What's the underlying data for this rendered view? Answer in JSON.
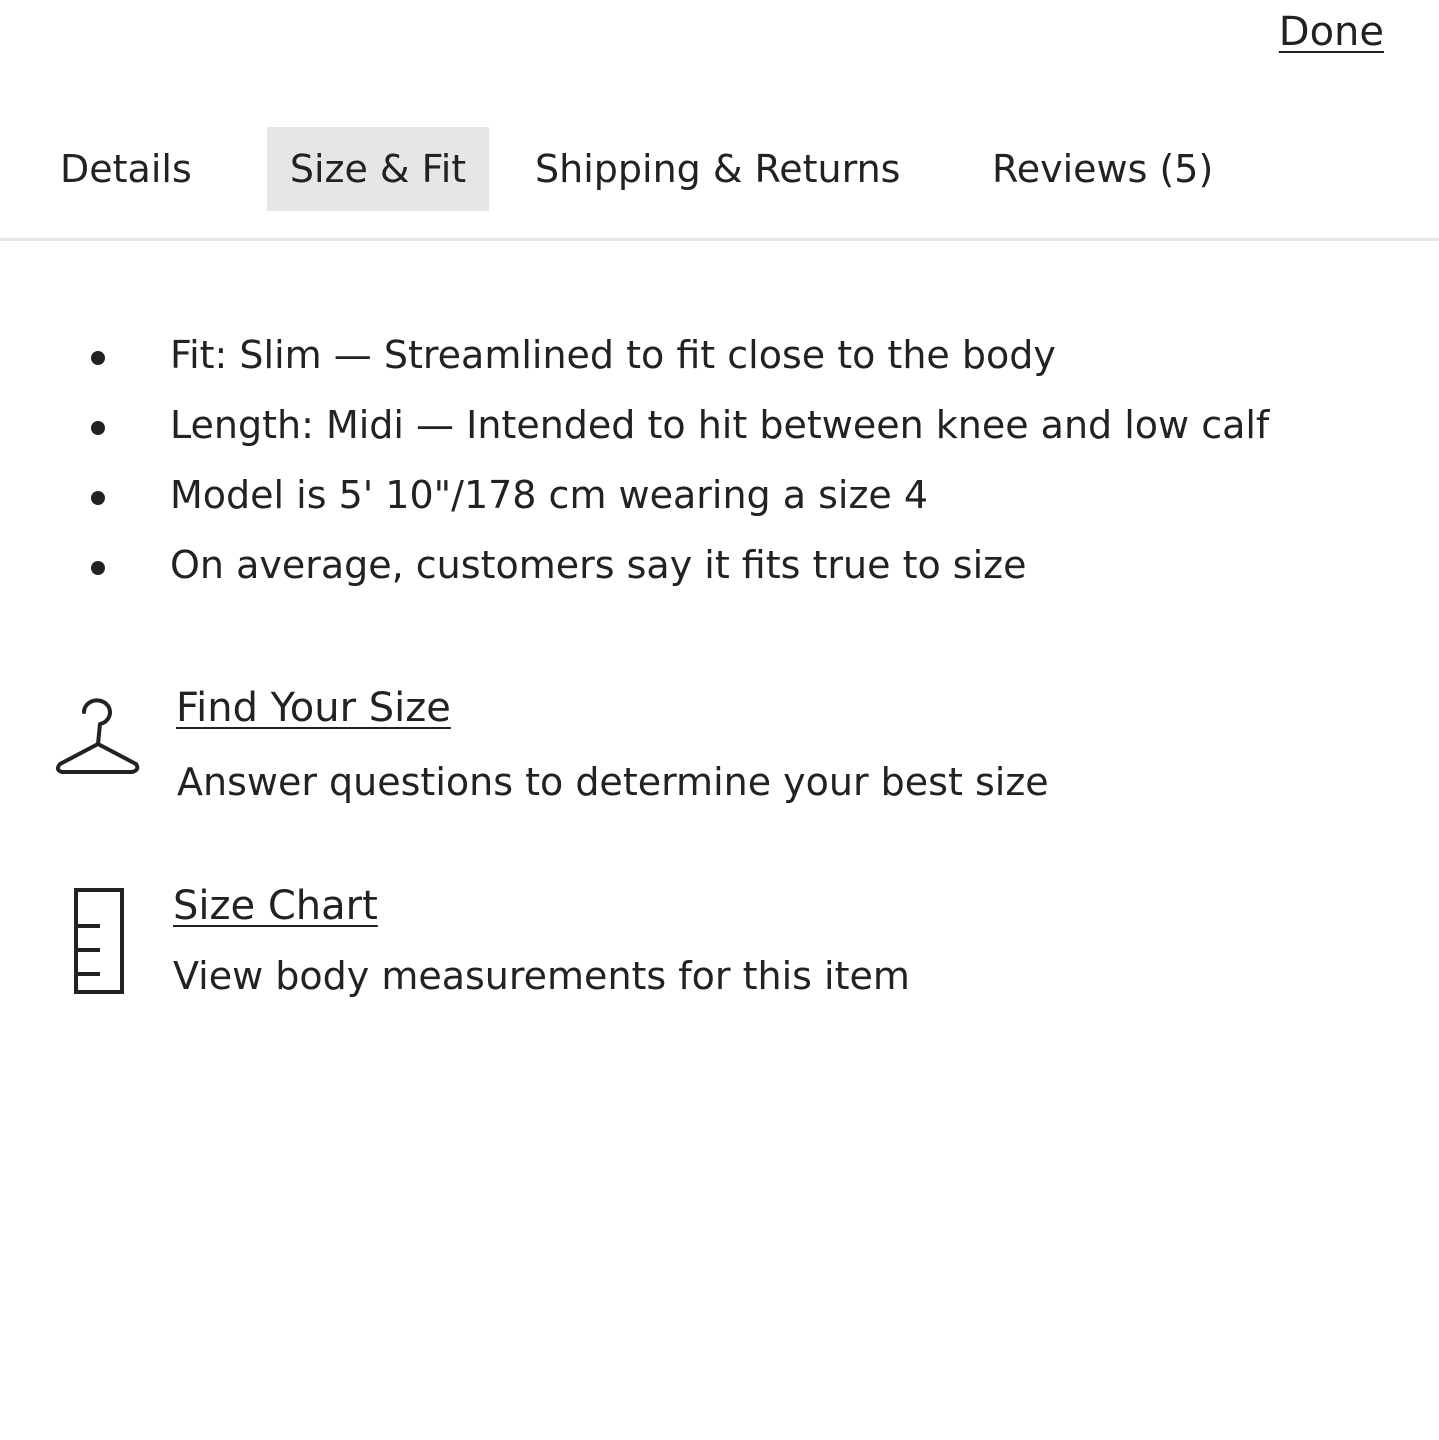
{
  "header": {
    "done_label": "Done"
  },
  "tabs": [
    {
      "label": "Details",
      "active": false
    },
    {
      "label": "Size & Fit",
      "active": true
    },
    {
      "label": "Shipping & Returns",
      "active": false
    },
    {
      "label": "Reviews (5)",
      "active": false
    }
  ],
  "fit_details": [
    "Fit: Slim — Streamlined to fit close to the body",
    "Length: Midi — Intended to hit between knee and low calf",
    "Model is 5' 10\"/178 cm wearing a size 4",
    "On average, customers say it fits true to size"
  ],
  "tools": {
    "find_size": {
      "icon": "hanger-icon",
      "title": "Find Your Size",
      "description": "Answer questions to determine your best size"
    },
    "size_chart": {
      "icon": "ruler-icon",
      "title": "Size Chart",
      "description": "View body measurements for this item"
    }
  },
  "colors": {
    "text": "#222222",
    "active_tab_bg": "#e6e6e6",
    "divider": "#e6e6e6",
    "background": "#ffffff"
  }
}
